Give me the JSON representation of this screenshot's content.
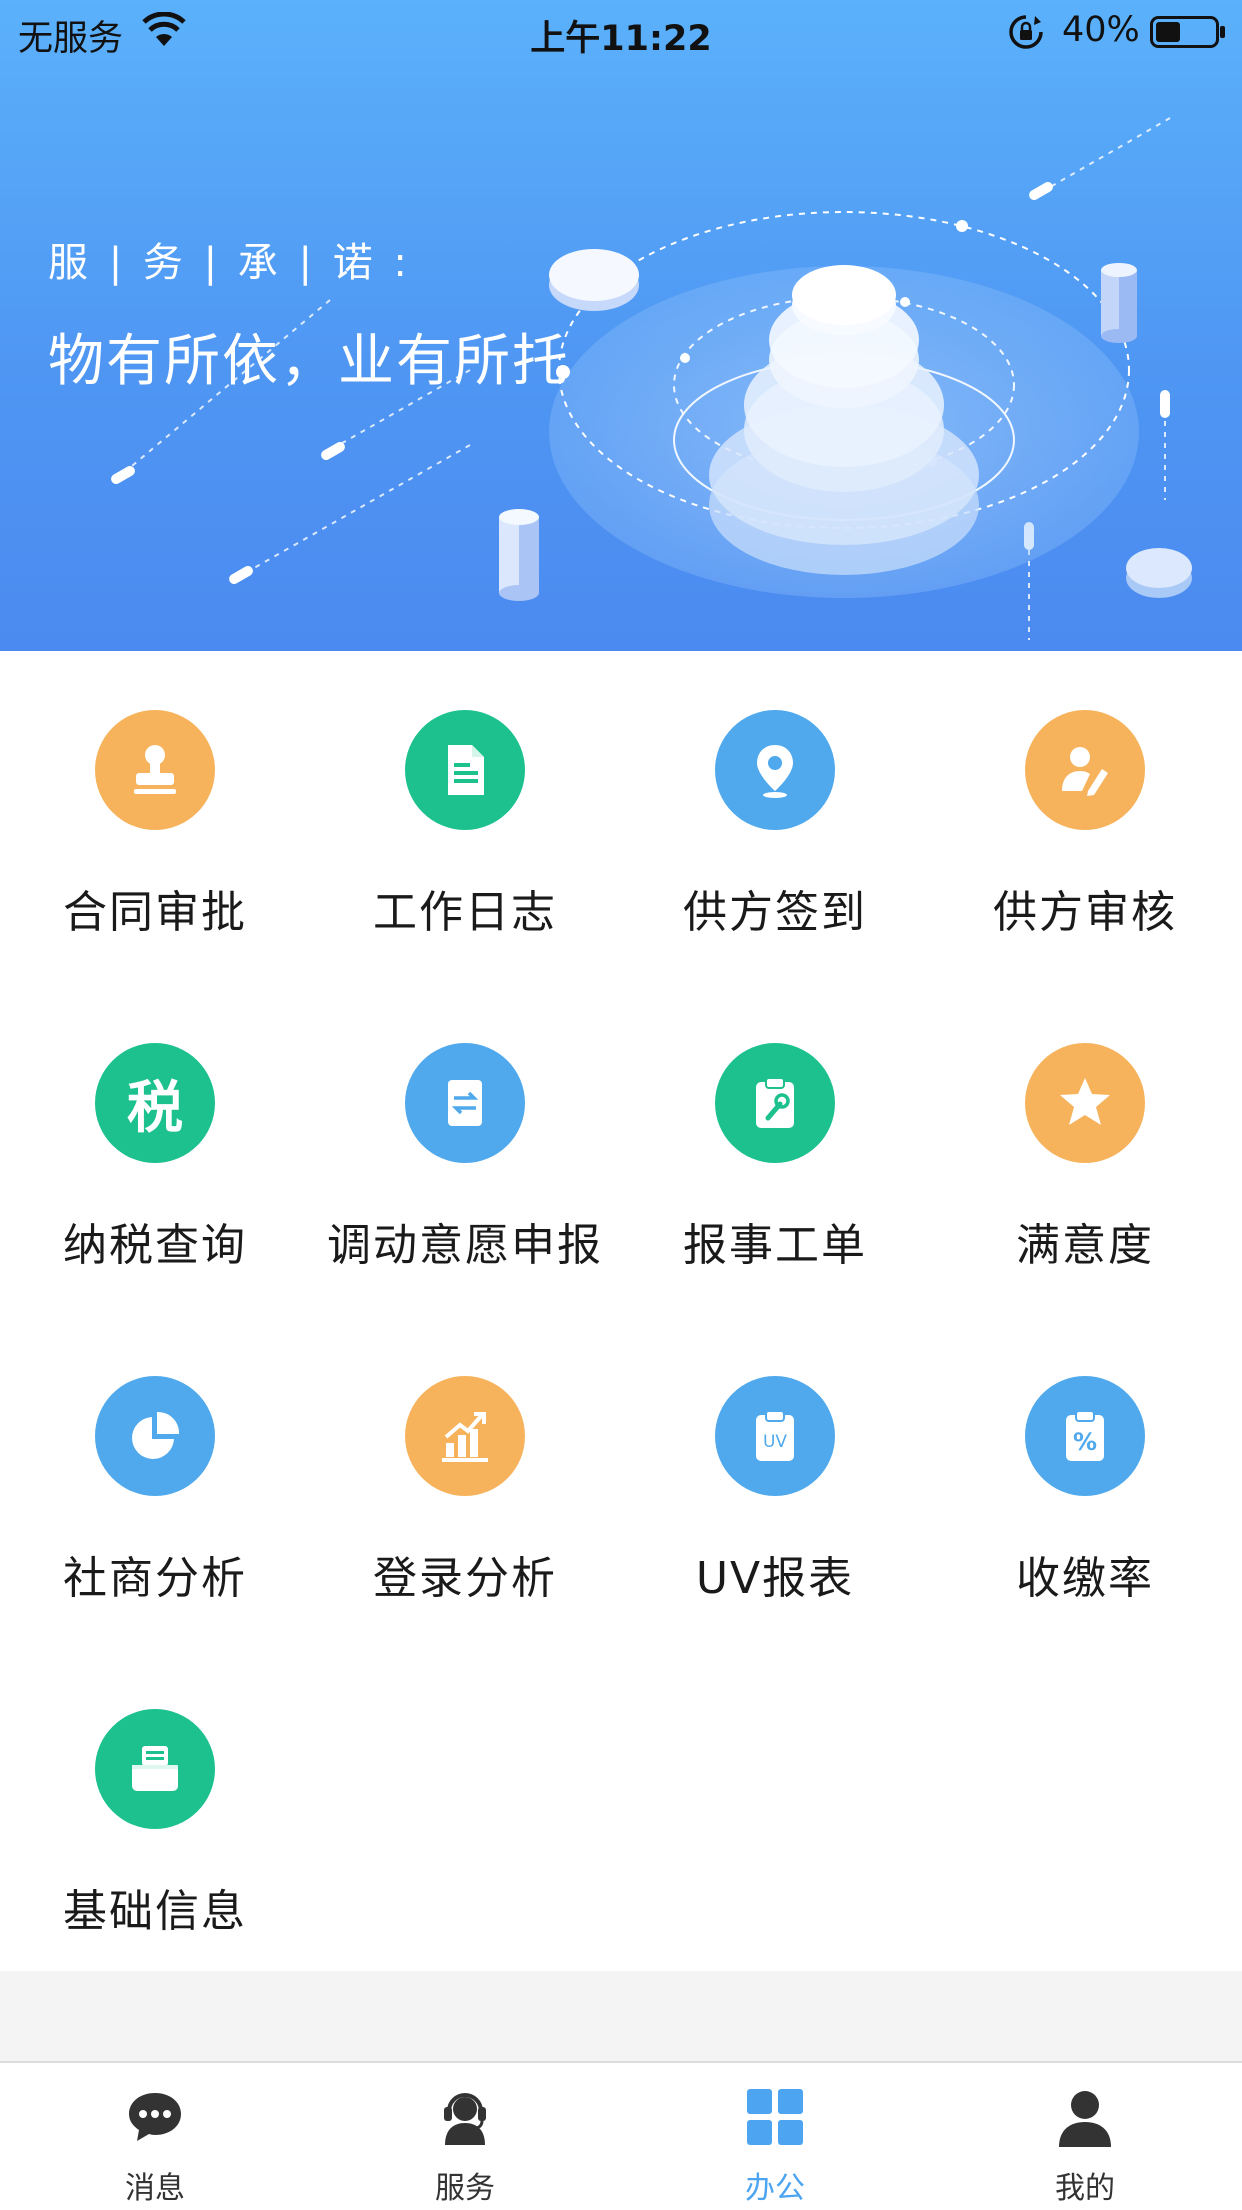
{
  "status_bar": {
    "carrier": "无服务",
    "time": "上午11:22",
    "battery": "40%"
  },
  "banner": {
    "label": "服 | 务 | 承 | 诺 :",
    "slogan": "物有所依，业有所托"
  },
  "colors": {
    "orange": "#f6b35c",
    "green": "#1cc18e",
    "blue": "#4fa9ec",
    "tab_active": "#4da4f0"
  },
  "grid": {
    "items": [
      {
        "label": "合同审批",
        "icon": "stamp-icon",
        "color": "orange"
      },
      {
        "label": "工作日志",
        "icon": "document-icon",
        "color": "green"
      },
      {
        "label": "供方签到",
        "icon": "location-pin-icon",
        "color": "blue"
      },
      {
        "label": "供方审核",
        "icon": "user-edit-icon",
        "color": "orange"
      },
      {
        "label": "纳税查询",
        "icon": "tax-icon",
        "glyph": "税",
        "color": "green"
      },
      {
        "label": "调动意愿申报",
        "icon": "transfer-doc-icon",
        "color": "blue"
      },
      {
        "label": "报事工单",
        "icon": "clipboard-wrench-icon",
        "color": "green"
      },
      {
        "label": "满意度",
        "icon": "star-icon",
        "color": "orange"
      },
      {
        "label": "社商分析",
        "icon": "pie-chart-icon",
        "color": "blue"
      },
      {
        "label": "登录分析",
        "icon": "bar-chart-icon",
        "color": "orange"
      },
      {
        "label": "UV报表",
        "icon": "uv-clipboard-icon",
        "glyph": "UV",
        "color": "blue"
      },
      {
        "label": "收缴率",
        "icon": "percent-clipboard-icon",
        "glyph": "%",
        "color": "blue"
      },
      {
        "label": "基础信息",
        "icon": "printer-icon",
        "color": "green"
      }
    ]
  },
  "tabbar": {
    "tabs": [
      {
        "label": "消息",
        "icon": "chat-bubble-icon",
        "active": false
      },
      {
        "label": "服务",
        "icon": "headset-icon",
        "active": false
      },
      {
        "label": "办公",
        "icon": "grid-icon",
        "active": true
      },
      {
        "label": "我的",
        "icon": "person-icon",
        "active": false
      }
    ]
  }
}
